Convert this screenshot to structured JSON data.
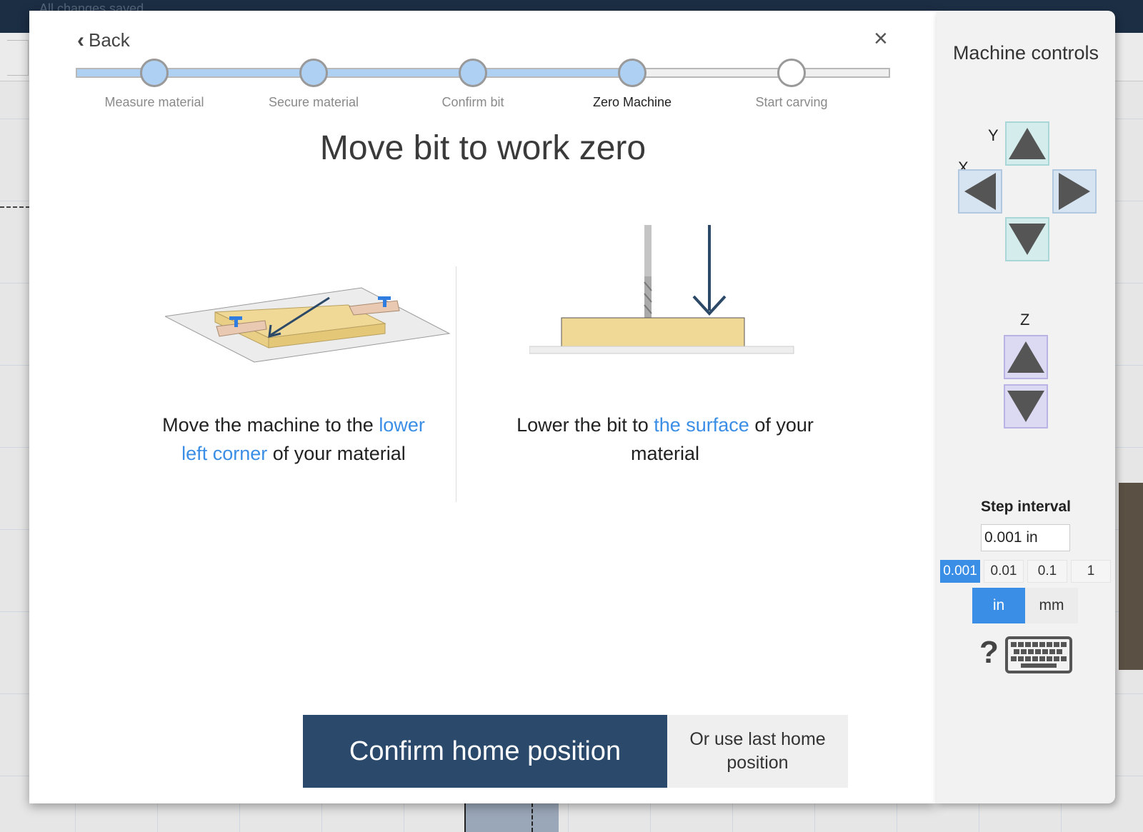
{
  "background": {
    "saved_text": "All changes saved"
  },
  "modal": {
    "back_label": "Back",
    "close_symbol": "×",
    "steps": [
      {
        "label": "Measure material",
        "state": "done"
      },
      {
        "label": "Secure material",
        "state": "done"
      },
      {
        "label": "Confirm bit",
        "state": "done"
      },
      {
        "label": "Zero Machine",
        "state": "current"
      },
      {
        "label": "Start carving",
        "state": "pending"
      }
    ],
    "headline": "Move bit to work zero",
    "left_caption": {
      "before": "Move the machine to the ",
      "highlight": "lower left corner",
      "after": " of your material"
    },
    "right_caption": {
      "before": "Lower the bit to ",
      "highlight": "the surface",
      "after": " of your material"
    },
    "confirm_button": "Confirm home position",
    "last_home_button": "Or use last home position"
  },
  "panel": {
    "title": "Machine controls",
    "axis_y": "Y",
    "axis_x": "X",
    "axis_z": "Z",
    "jog_icons": [
      "arrow-up",
      "arrow-left",
      "arrow-right",
      "arrow-down"
    ],
    "step_interval_title": "Step interval",
    "step_interval_value": "0.001 in",
    "interval_options": [
      "0.001",
      "0.01",
      "0.1",
      "1"
    ],
    "selected_interval": "0.001",
    "units": [
      "in",
      "mm"
    ],
    "selected_unit": "in",
    "help_symbol": "?"
  },
  "colors": {
    "accent": "#3b8ee6",
    "confirm_bg": "#2b4a6b",
    "step_fill": "#aed0f2",
    "material": "#f0d896"
  }
}
